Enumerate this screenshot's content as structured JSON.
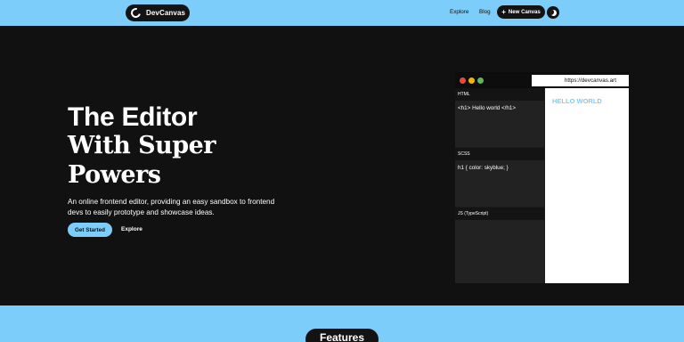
{
  "nav": {
    "brand": "DevCanvas",
    "links": [
      "Explore",
      "Blog"
    ],
    "new_button": "New Canvas",
    "new_icon": "+",
    "theme_icon": "moon-icon"
  },
  "hero": {
    "title_line1": "The Editor",
    "title_line2": "With Super",
    "title_line3": "Powers",
    "description": "An online frontend editor, providing an easy sandbox to frontend devs to easily prototype and showcase ideas.",
    "primary_cta": "Get Started",
    "secondary_cta": "Explore"
  },
  "editor": {
    "url": "https://devcanvas.art",
    "panes": [
      {
        "label": "HTML",
        "code": "<h1> Hello world </h1>"
      },
      {
        "label": "SCSS",
        "code": "h1 { color: skyblue; }"
      },
      {
        "label": "JS (TypeScript)",
        "code": ""
      }
    ],
    "preview_text": "HELLO WORLD"
  },
  "section": {
    "features_title": "Features"
  },
  "colors": {
    "accent": "#7ccdf9",
    "dark": "#111111",
    "dot_red": "#e54b3d",
    "dot_yellow": "#f4b400",
    "dot_green": "#5cb85c"
  }
}
